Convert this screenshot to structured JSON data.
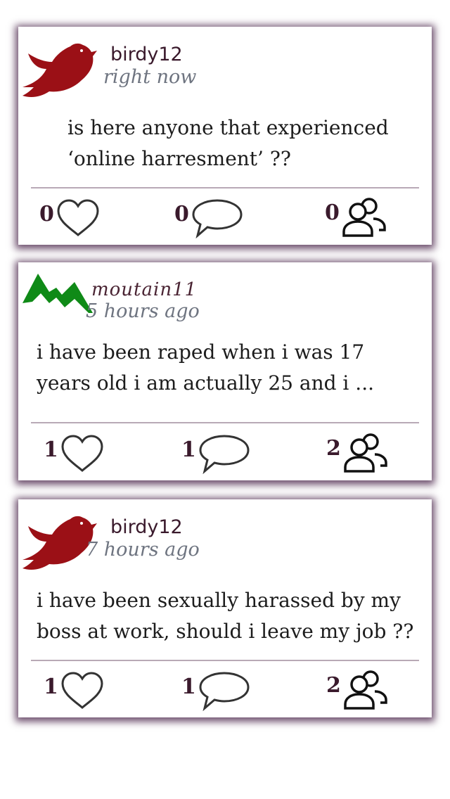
{
  "posts": [
    {
      "avatar": "red-bird-icon",
      "username": "birdy12",
      "time": "right now",
      "text_line1": "is here anyone that experienced",
      "text_line2": "‘online harresment’ ??",
      "likes": "0",
      "comments": "0",
      "followers": "0"
    },
    {
      "avatar": "green-mountain-icon",
      "username": "moutain11",
      "time": "5 hours ago",
      "text_line1": "i have been raped when i was 17",
      "text_line2": "years old i am actually 25 and i ...",
      "likes": "1",
      "comments": "1",
      "followers": "2"
    },
    {
      "avatar": "red-bird-icon",
      "username": "birdy12",
      "time": "7 hours ago",
      "text_line1": "i have been sexually harassed by my",
      "text_line2": "boss at work, should i leave my job ??",
      "likes": "1",
      "comments": "1",
      "followers": "2"
    }
  ],
  "colors": {
    "bird": "#9b1016",
    "mountain": "#0f8a17",
    "shadow": "#3c143c"
  }
}
